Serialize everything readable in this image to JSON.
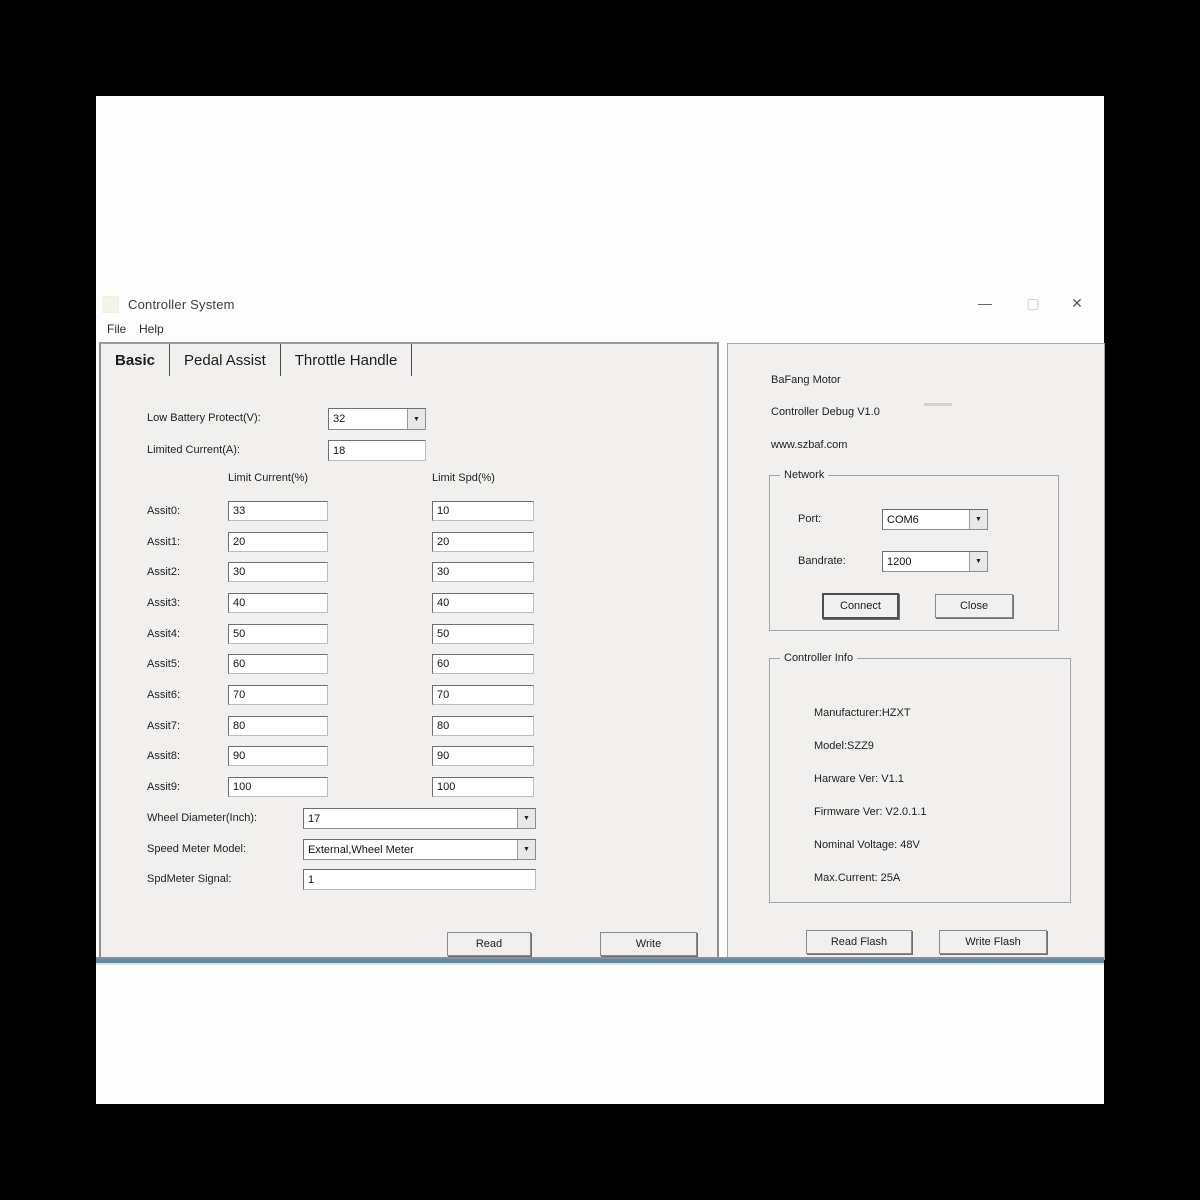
{
  "window": {
    "title": "Controller System",
    "menus": {
      "file": "File",
      "help": "Help"
    },
    "controls": {
      "minimize": "—",
      "maximize": "▢",
      "close": "✕"
    }
  },
  "icons": {
    "dropdown_arrow": "▼"
  },
  "tabs": [
    {
      "label": "Basic"
    },
    {
      "label": "Pedal Assist"
    },
    {
      "label": "Throttle Handle"
    }
  ],
  "basic": {
    "low_battery_protect": {
      "label": "Low Battery Protect(V):",
      "value": "32"
    },
    "limited_current": {
      "label": "Limited Current(A):",
      "value": "18"
    },
    "columns": {
      "current": "Limit Current(%)",
      "speed": "Limit Spd(%)"
    },
    "assist_rows": [
      {
        "label": "Assit0:",
        "current": "33",
        "speed": "10"
      },
      {
        "label": "Assit1:",
        "current": "20",
        "speed": "20"
      },
      {
        "label": "Assit2:",
        "current": "30",
        "speed": "30"
      },
      {
        "label": "Assit3:",
        "current": "40",
        "speed": "40"
      },
      {
        "label": "Assit4:",
        "current": "50",
        "speed": "50"
      },
      {
        "label": "Assit5:",
        "current": "60",
        "speed": "60"
      },
      {
        "label": "Assit6:",
        "current": "70",
        "speed": "70"
      },
      {
        "label": "Assit7:",
        "current": "80",
        "speed": "80"
      },
      {
        "label": "Assit8:",
        "current": "90",
        "speed": "90"
      },
      {
        "label": "Assit9:",
        "current": "100",
        "speed": "100"
      }
    ],
    "wheel_diameter": {
      "label": "Wheel Diameter(Inch):",
      "value": "17"
    },
    "speed_meter_model": {
      "label": "Speed Meter Model:",
      "value": "External,Wheel Meter"
    },
    "spdmeter_signal": {
      "label": "SpdMeter Signal:",
      "value": "1"
    },
    "buttons": {
      "read": "Read",
      "write": "Write"
    }
  },
  "right_panel": {
    "brand": {
      "line1": "BaFang Motor",
      "line2": "Controller Debug V1.0",
      "line3": "www.szbaf.com"
    },
    "network": {
      "title": "Network",
      "port_label": "Port:",
      "port_value": "COM6",
      "baud_label": "Bandrate:",
      "baud_value": "1200",
      "connect": "Connect",
      "close": "Close"
    },
    "controller_info": {
      "title": "Controller Info",
      "lines": [
        "Manufacturer:HZXT",
        "Model:SZZ9",
        "Harware Ver: V1.1",
        "Firmware Ver: V2.0.1.1",
        "Nominal Voltage: 48V",
        "Max.Current: 25A"
      ]
    },
    "buttons": {
      "read_flash": "Read Flash",
      "write_flash": "Write Flash"
    }
  },
  "colors": {
    "accent_line": "#5d89a6",
    "panel_bg": "#f1f0ee"
  }
}
